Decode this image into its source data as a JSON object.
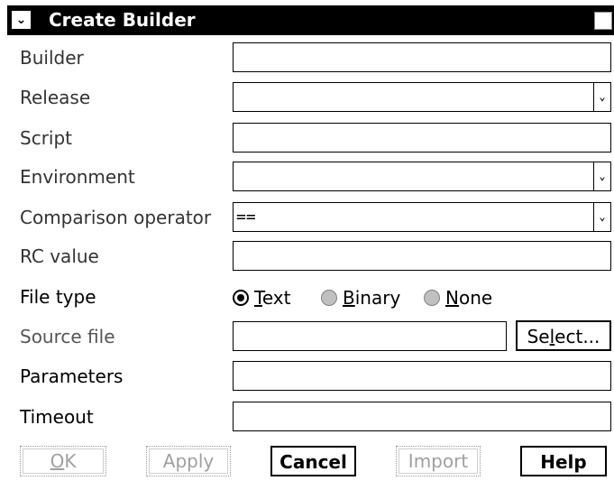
{
  "window": {
    "title": "Create Builder",
    "system_menu_icon": "chevron-down-icon",
    "maximize_icon": "maximize-icon"
  },
  "labels": {
    "builder": "Builder",
    "release": "Release",
    "script": "Script",
    "environment": "Environment",
    "comparison_operator": "Comparison operator",
    "rc_value": "RC value",
    "file_type": "File type",
    "source_file": "Source file",
    "parameters": "Parameters",
    "timeout": "Timeout"
  },
  "fields": {
    "builder": "",
    "release": "",
    "script": "",
    "environment": "",
    "comparison_operator": "==",
    "rc_value": "",
    "source_file": "",
    "parameters": "",
    "timeout": ""
  },
  "file_type": {
    "selected": "Text",
    "options": [
      {
        "pre": "",
        "accel": "T",
        "post": "ext"
      },
      {
        "pre": "",
        "accel": "B",
        "post": "inary"
      },
      {
        "pre": "",
        "accel": "N",
        "post": "one"
      }
    ]
  },
  "select_button": {
    "pre": "Se",
    "accel": "l",
    "post": "ect..."
  },
  "buttons": {
    "ok": {
      "pre": "",
      "accel": "O",
      "post": "K"
    },
    "apply": "Apply",
    "cancel": "Cancel",
    "import": "Import",
    "help": "Help"
  }
}
